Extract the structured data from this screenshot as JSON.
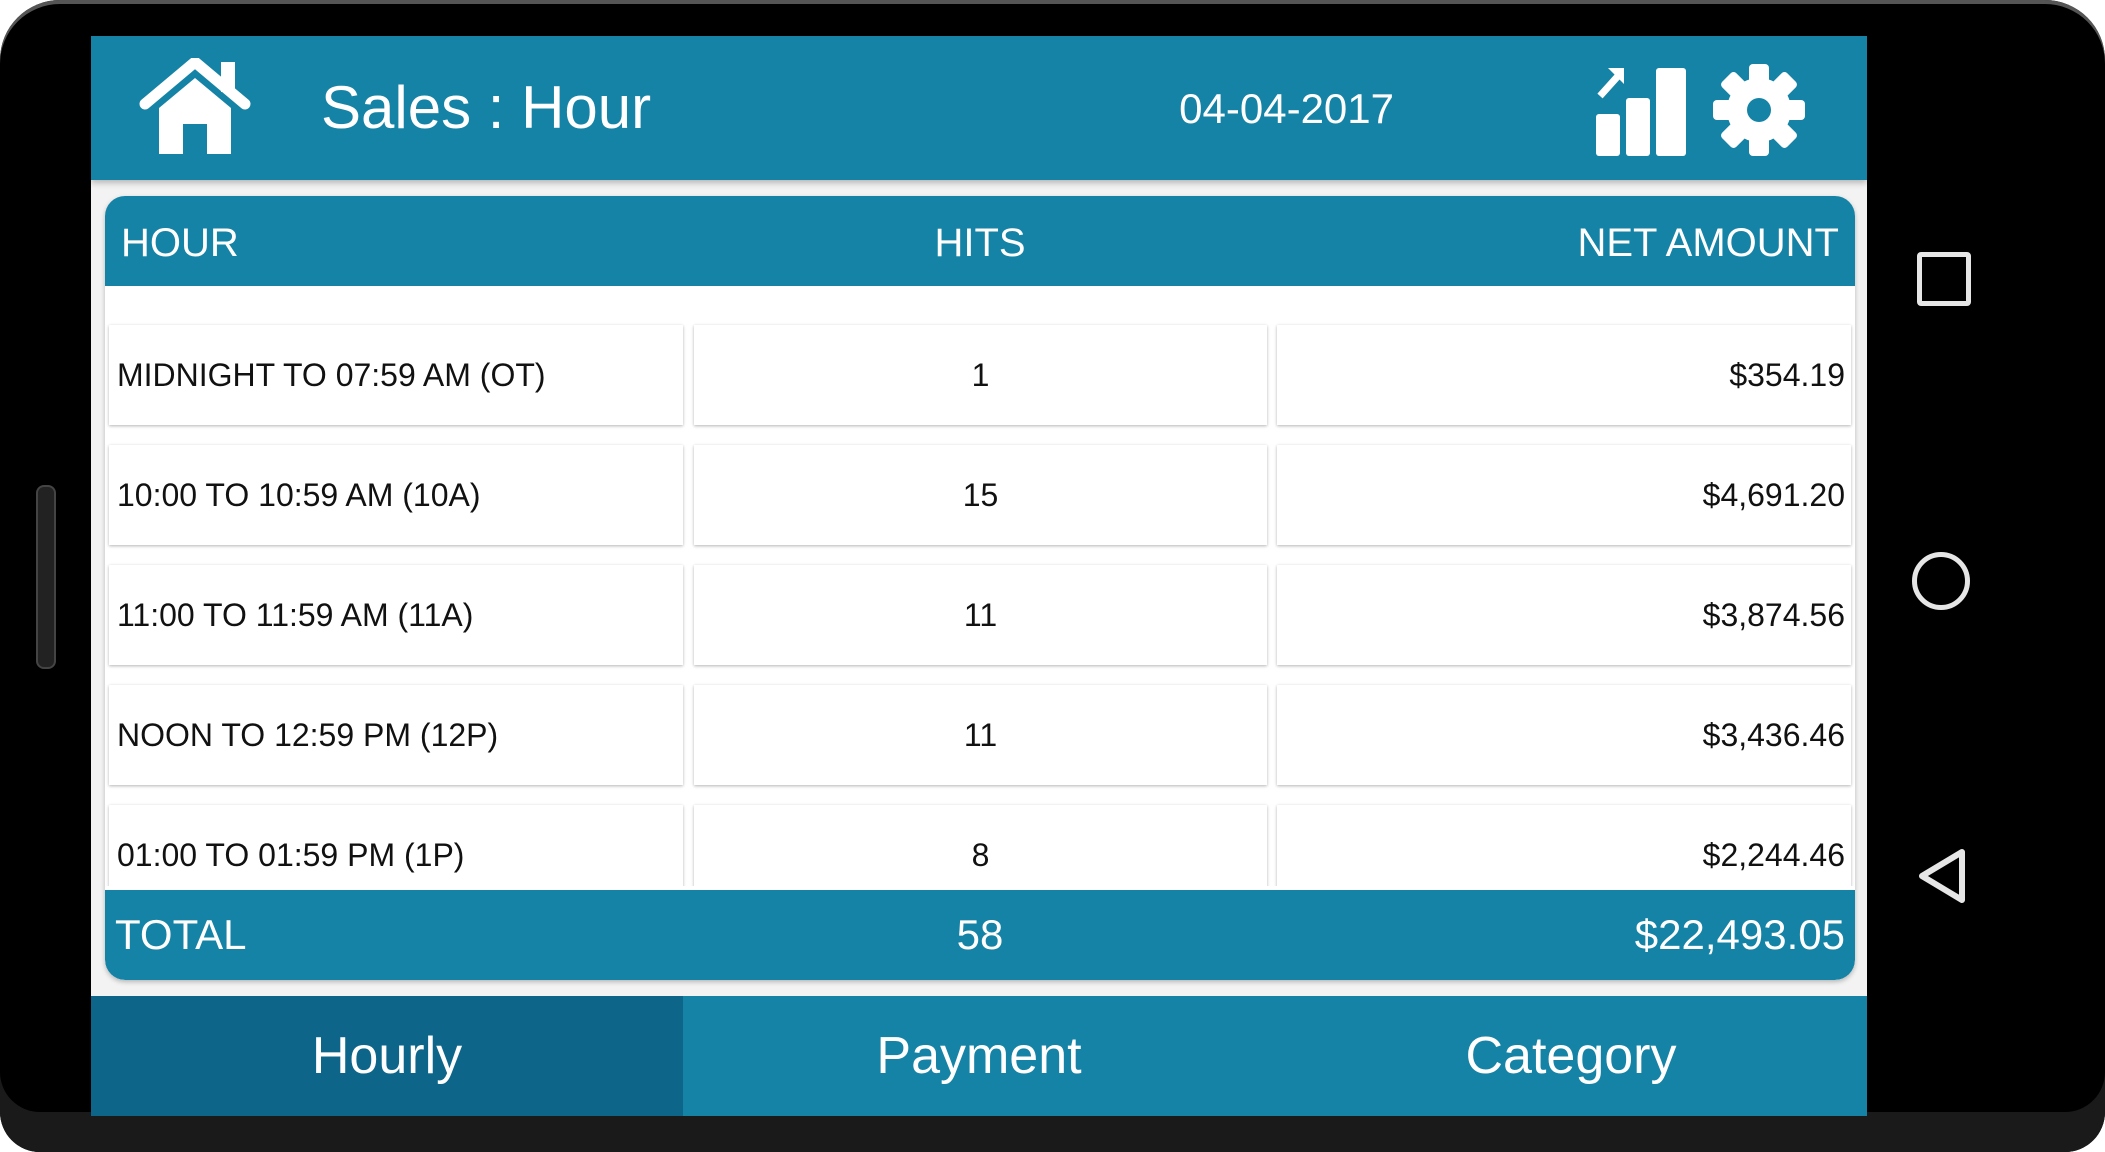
{
  "header": {
    "title": "Sales : Hour",
    "date": "04-04-2017",
    "icons": [
      "home-icon",
      "bar-chart-growth-icon",
      "gear-icon"
    ]
  },
  "colors": {
    "primary": "#1583a6",
    "tab_active": "#0d6689",
    "background": "#f3f3f3"
  },
  "table": {
    "columns": [
      "HOUR",
      "HITS",
      "NET AMOUNT"
    ],
    "rows": [
      {
        "hour": "MIDNIGHT TO 07:59 AM (OT)",
        "hits": "1",
        "amount": "$354.19"
      },
      {
        "hour": "10:00 TO 10:59 AM (10A)",
        "hits": "15",
        "amount": "$4,691.20"
      },
      {
        "hour": "11:00 TO 11:59 AM (11A)",
        "hits": "11",
        "amount": "$3,874.56"
      },
      {
        "hour": "NOON TO 12:59 PM (12P)",
        "hits": "11",
        "amount": "$3,436.46"
      },
      {
        "hour": "01:00 TO 01:59 PM (1P)",
        "hits": "8",
        "amount": "$2,244.46"
      }
    ],
    "total": {
      "label": "TOTAL",
      "hits": "58",
      "amount": "$22,493.05"
    }
  },
  "tabs": [
    {
      "label": "Hourly",
      "active": true
    },
    {
      "label": "Payment",
      "active": false
    },
    {
      "label": "Category",
      "active": false
    }
  ],
  "system_nav": [
    "recent-apps",
    "home",
    "back"
  ]
}
